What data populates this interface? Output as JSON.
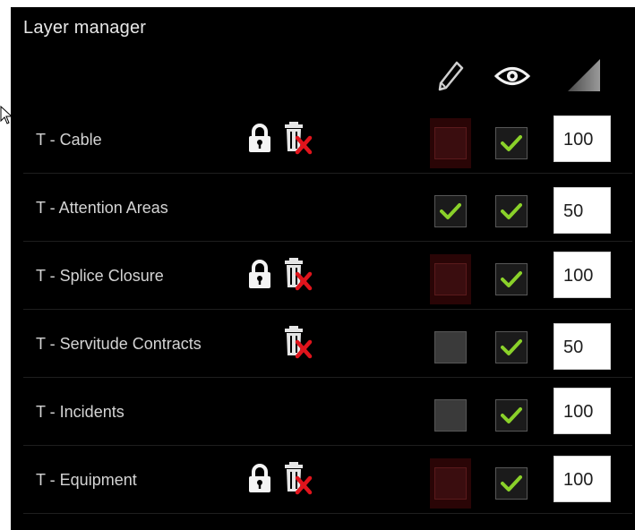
{
  "header": {
    "title": "Layer manager",
    "columns": [
      {
        "id": "edit",
        "icon": "pencil-icon"
      },
      {
        "id": "visible",
        "icon": "eye-icon"
      },
      {
        "id": "opacity",
        "icon": "opacity-wedge-icon"
      }
    ]
  },
  "layers": [
    {
      "name": "T - Cable",
      "locked": true,
      "deletable_icon": true,
      "editable": false,
      "edit_checked": false,
      "visible": true,
      "opacity": "100"
    },
    {
      "name": "T - Attention Areas",
      "locked": false,
      "deletable_icon": false,
      "editable": true,
      "edit_checked": true,
      "visible": true,
      "opacity": "50"
    },
    {
      "name": "T - Splice Closure",
      "locked": true,
      "deletable_icon": true,
      "editable": false,
      "edit_checked": false,
      "visible": true,
      "opacity": "100"
    },
    {
      "name": "T - Servitude Contracts",
      "locked": false,
      "deletable_icon": true,
      "editable": true,
      "edit_checked": false,
      "visible": true,
      "opacity": "50"
    },
    {
      "name": "T - Incidents",
      "locked": false,
      "deletable_icon": false,
      "editable": true,
      "edit_checked": false,
      "visible": true,
      "opacity": "100"
    },
    {
      "name": "T - Equipment",
      "locked": true,
      "deletable_icon": true,
      "editable": false,
      "edit_checked": false,
      "visible": true,
      "opacity": "100"
    }
  ],
  "colors": {
    "background": "#000000",
    "check": "#8ad12a",
    "locked_cell": "#2a0506",
    "delete_x": "#e0141c"
  }
}
